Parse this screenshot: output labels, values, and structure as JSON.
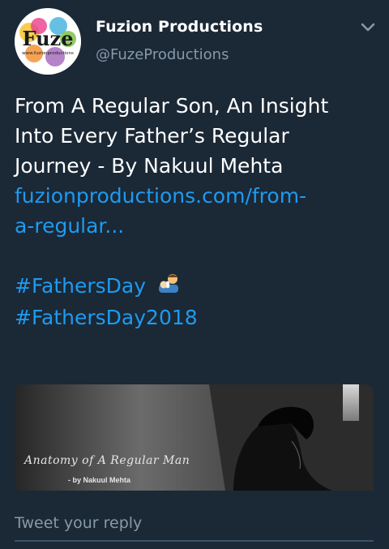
{
  "account": {
    "name": "Fuzion Productions",
    "handle": "@FuzeProductions",
    "avatar_text": "Fuze",
    "avatar_subtext": "www.fuzionproductions"
  },
  "tweet": {
    "text_lines": [
      "From A Regular Son, An Insight",
      "Into Every Father’s Regular",
      "Journey - By Nakuul Mehta"
    ],
    "link_lines": [
      "fuzionproductions.com/from-",
      "a-regular..."
    ],
    "hashtags": [
      "#FathersDay",
      "#FathersDay2018"
    ],
    "emoji": "man-feeding-baby"
  },
  "media": {
    "title": "Anatomy of A Regular Man",
    "subtitle": "- by Nakuul Mehta"
  },
  "reply": {
    "placeholder": "Tweet your reply"
  },
  "colors": {
    "background": "#1b2836",
    "link": "#1d9bf0",
    "muted": "#8899a6"
  }
}
